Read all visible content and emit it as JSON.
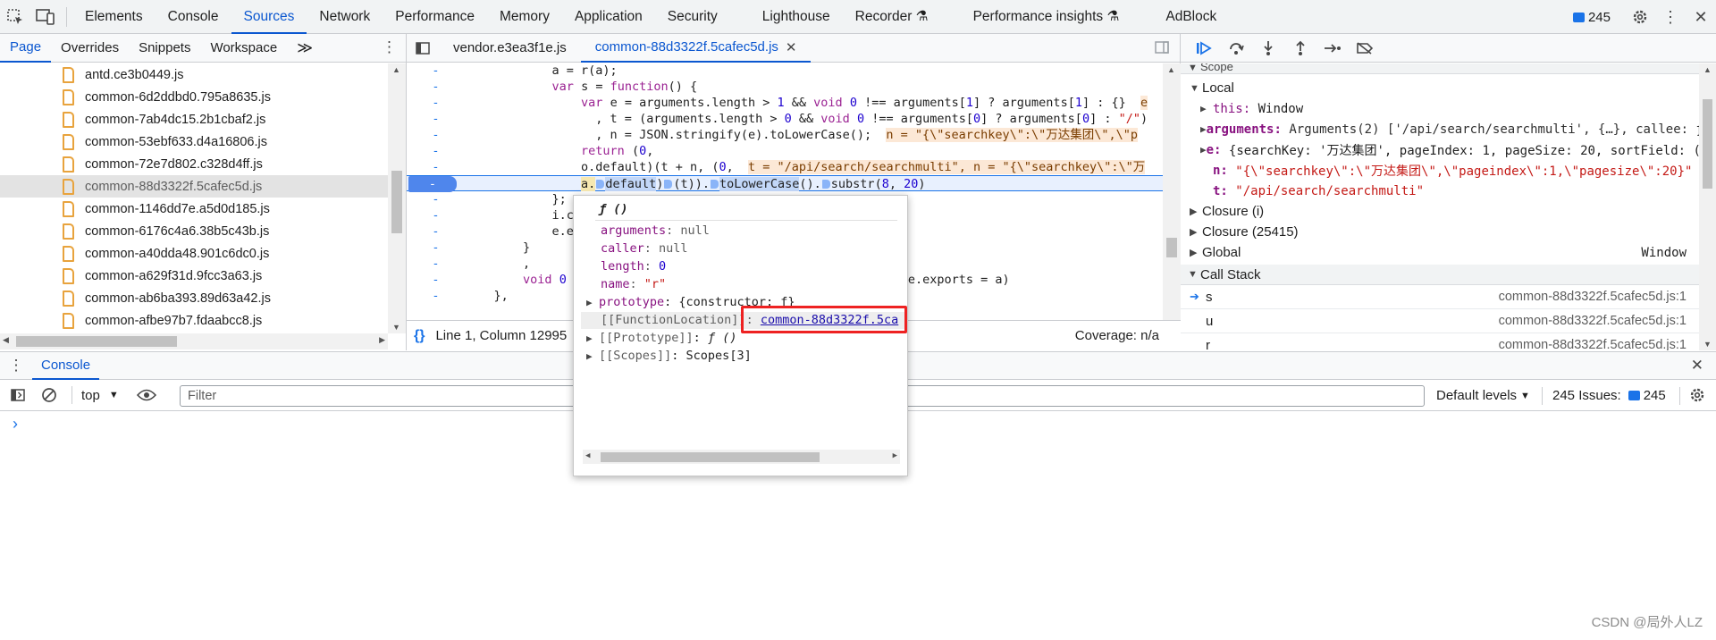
{
  "topbar": {
    "tabs": [
      "Elements",
      "Console",
      "Sources",
      "Network",
      "Performance",
      "Memory",
      "Application",
      "Security",
      "Lighthouse",
      "Recorder ⚗",
      "Performance insights ⚗",
      "AdBlock"
    ],
    "active_tab": "Sources",
    "issues_count": "245"
  },
  "navigator": {
    "tabs": [
      "Page",
      "Overrides",
      "Snippets",
      "Workspace"
    ],
    "files": [
      "antd.ce3b0449.js",
      "common-6d2ddbd0.795a8635.js",
      "common-7ab4dc15.2b1cbaf2.js",
      "common-53ebf633.d4a16806.js",
      "common-72e7d802.c328d4ff.js",
      "common-88d3322f.5cafec5d.js",
      "common-1146dd7e.a5d0d185.js",
      "common-6176c4a6.38b5c43b.js",
      "common-a40dda48.901c6dc0.js",
      "common-a629f31d.9fcc3a63.js",
      "common-ab6ba393.89d63a42.js",
      "common-afbe97b7.fdaabcc8.js"
    ],
    "selected_file": "common-88d3322f.5cafec5d.js"
  },
  "editor": {
    "tabs": [
      "vendor.e3ea3f1e.js",
      "common-88d3322f.5cafec5d.js"
    ],
    "status_position": "Line 1, Column 12995",
    "coverage": "Coverage: n/a"
  },
  "debugger": {
    "scope_header": "Scope",
    "local_header": "Local",
    "local": {
      "this_key": "this:",
      "this_val": "Window",
      "args_key": "arguments:",
      "args_val": "Arguments(2) ['/api/search/searchmulti', {…}, callee: ƒ",
      "e_key": "e:",
      "e_val": "{searchKey: '万达集团', pageIndex: 1, pageSize: 20, sortField: (",
      "n_key": "n:",
      "n_val": "\"{\\\"searchkey\\\":\\\"万达集团\\\",\\\"pageindex\\\":1,\\\"pagesize\\\":20}\"",
      "t_key": "t:",
      "t_val": "\"/api/search/searchmulti\""
    },
    "closure1": "Closure (i)",
    "closure2": "Closure (25415)",
    "global": "Global",
    "global_val": "Window",
    "call_stack_header": "Call Stack",
    "call_stack": [
      {
        "fn": "s",
        "loc": "common-88d3322f.5cafec5d.js:1"
      },
      {
        "fn": "u",
        "loc": "common-88d3322f.5cafec5d.js:1"
      },
      {
        "fn": "r",
        "loc": "common-88d3322f.5cafec5d.js:1"
      }
    ]
  },
  "popover": {
    "title": "ƒ ()",
    "arguments_key": "arguments",
    "arguments_val": "null",
    "caller_key": "caller",
    "caller_val": "null",
    "length_key": "length",
    "length_val": "0",
    "name_key": "name",
    "name_val": "\"r\"",
    "prototype_key": "prototype",
    "prototype_val": "{constructor: ƒ}",
    "location_key": "[[FunctionLocation]]",
    "location_val": "common-88d3322f.5ca",
    "proto_key": "[[Prototype]]",
    "proto_val": "ƒ ()",
    "scopes_key": "[[Scopes]]",
    "scopes_val": "Scopes[3]"
  },
  "drawer": {
    "tab": "Console",
    "context": "top",
    "filter_placeholder": "Filter",
    "levels": "Default levels",
    "issues_label": "245 Issues:",
    "issues_count": "245",
    "prompt": "›"
  },
  "watermark": "CSDN @局外人LZ"
}
